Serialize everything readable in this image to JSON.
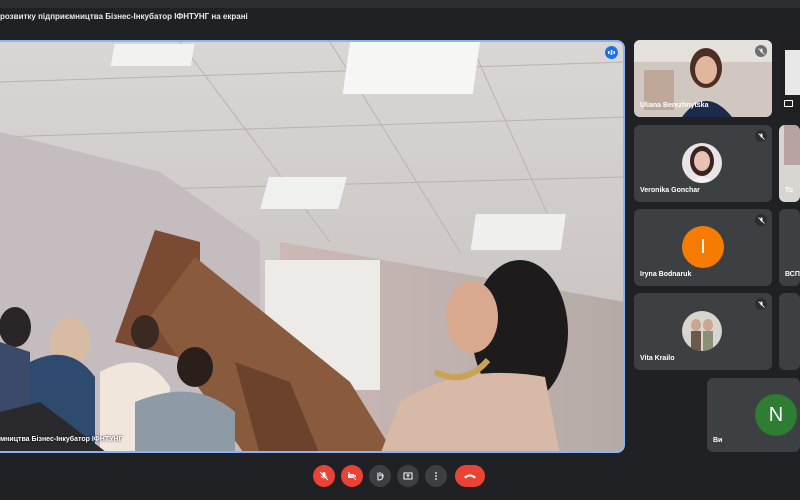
{
  "presentation": {
    "title": "розвитку підприємництва Бізнес-Інкубатор ІФНТУНГ на екрані",
    "main_label": "мництва Бізнес-Інкубатор ІФНТУНГ"
  },
  "participants": [
    {
      "name": "Uliana Berezhnytska",
      "muted": true
    },
    {
      "name": "Veronika Gonchar",
      "muted": true
    },
    {
      "name": "Iryna Bodnaruk",
      "muted": true,
      "initial": "I",
      "color": "#f57c00"
    },
    {
      "name": "Vita Krailo",
      "muted": true
    },
    {
      "name": "Ви",
      "initial": "N",
      "color": "#2e7d32"
    }
  ],
  "partial_tiles": [
    {
      "name": "Tu"
    },
    {
      "name": "ВСП"
    }
  ],
  "controls": {
    "mic": "mic-off-icon",
    "camera": "camera-off-icon",
    "hand": "raise-hand-icon",
    "present": "present-screen-icon",
    "more": "more-vert-icon",
    "hangup": "end-call-icon"
  },
  "colors": {
    "background": "#202124",
    "tile": "#3c4043",
    "accent": "#8ab4f8",
    "danger": "#ea4335"
  }
}
